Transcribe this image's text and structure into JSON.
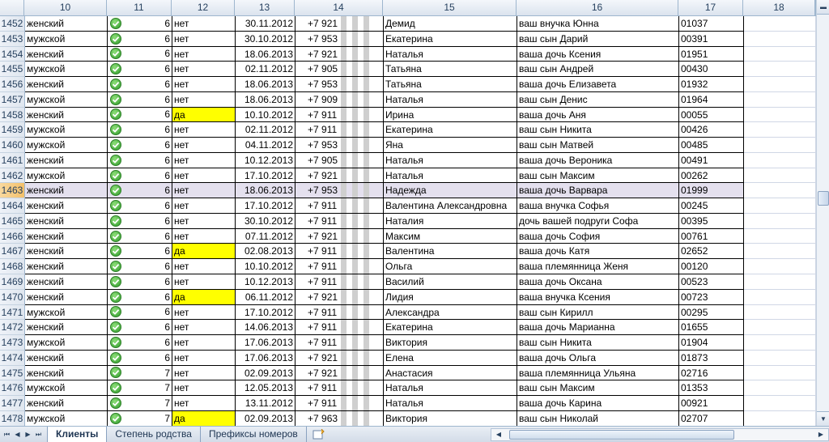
{
  "columns": [
    "10",
    "11",
    "12",
    "13",
    "14",
    "15",
    "16",
    "17",
    "18"
  ],
  "rows": [
    {
      "n": "1452",
      "gender": "женский",
      "num": "6",
      "flag": "нет",
      "date": "30.11.2012",
      "phone": "+7 921",
      "name": "Демид",
      "relation": "ваш внучка Юнна",
      "code": "01037"
    },
    {
      "n": "1453",
      "gender": "мужской",
      "num": "6",
      "flag": "нет",
      "date": "30.10.2012",
      "phone": "+7 953",
      "name": "Екатерина",
      "relation": "ваш сын Дарий",
      "code": "00391"
    },
    {
      "n": "1454",
      "gender": "женский",
      "num": "6",
      "flag": "нет",
      "date": "18.06.2013",
      "phone": "+7 921",
      "name": "Наталья",
      "relation": "ваша дочь Ксения",
      "code": "01951"
    },
    {
      "n": "1455",
      "gender": "мужской",
      "num": "6",
      "flag": "нет",
      "date": "02.11.2012",
      "phone": "+7 905",
      "name": "Татьяна",
      "relation": "ваш сын Андрей",
      "code": "00430"
    },
    {
      "n": "1456",
      "gender": "женский",
      "num": "6",
      "flag": "нет",
      "date": "18.06.2013",
      "phone": "+7 953",
      "name": "Татьяна",
      "relation": "ваша дочь Елизавета",
      "code": "01932"
    },
    {
      "n": "1457",
      "gender": "мужской",
      "num": "6",
      "flag": "нет",
      "date": "18.06.2013",
      "phone": "+7 909",
      "name": "Наталья",
      "relation": "ваш сын Денис",
      "code": "01964"
    },
    {
      "n": "1458",
      "gender": "женский",
      "num": "6",
      "flag": "да",
      "date": "10.10.2012",
      "phone": "+7 911",
      "name": "Ирина",
      "relation": "ваша дочь Аня",
      "code": "00055"
    },
    {
      "n": "1459",
      "gender": "мужской",
      "num": "6",
      "flag": "нет",
      "date": "02.11.2012",
      "phone": "+7 911",
      "name": "Екатерина",
      "relation": "ваш сын Никита",
      "code": "00426"
    },
    {
      "n": "1460",
      "gender": "мужской",
      "num": "6",
      "flag": "нет",
      "date": "04.11.2012",
      "phone": "+7 953",
      "name": "Яна",
      "relation": "ваш сын Матвей",
      "code": "00485"
    },
    {
      "n": "1461",
      "gender": "женский",
      "num": "6",
      "flag": "нет",
      "date": "10.12.2013",
      "phone": "+7 905",
      "name": "Наталья",
      "relation": "ваша дочь Вероника",
      "code": "00491"
    },
    {
      "n": "1462",
      "gender": "мужской",
      "num": "6",
      "flag": "нет",
      "date": "17.10.2012",
      "phone": "+7 921",
      "name": "Наталья",
      "relation": "ваш сын Максим",
      "code": "00262"
    },
    {
      "n": "1463",
      "gender": "женский",
      "num": "6",
      "flag": "нет",
      "date": "18.06.2013",
      "phone": "+7 953",
      "name": "Надежда",
      "relation": "ваша дочь Варвара",
      "code": "01999"
    },
    {
      "n": "1464",
      "gender": "женский",
      "num": "6",
      "flag": "нет",
      "date": "17.10.2012",
      "phone": "+7 911",
      "name": "Валентина Александровна",
      "relation": "ваша внучка Софья",
      "code": "00245"
    },
    {
      "n": "1465",
      "gender": "женский",
      "num": "6",
      "flag": "нет",
      "date": "30.10.2012",
      "phone": "+7 911",
      "name": "Наталия",
      "relation": "дочь вашей подруги Софа",
      "code": "00395"
    },
    {
      "n": "1466",
      "gender": "женский",
      "num": "6",
      "flag": "нет",
      "date": "07.11.2012",
      "phone": "+7 921",
      "name": "Максим",
      "relation": "ваша дочь София",
      "code": "00761"
    },
    {
      "n": "1467",
      "gender": "женский",
      "num": "6",
      "flag": "да",
      "date": "02.08.2013",
      "phone": "+7 911",
      "name": "Валентина",
      "relation": "ваша дочь Катя",
      "code": "02652"
    },
    {
      "n": "1468",
      "gender": "женский",
      "num": "6",
      "flag": "нет",
      "date": "10.10.2012",
      "phone": "+7 911",
      "name": "Ольга",
      "relation": "ваша племянница Женя",
      "code": "00120"
    },
    {
      "n": "1469",
      "gender": "женский",
      "num": "6",
      "flag": "нет",
      "date": "10.12.2013",
      "phone": "+7 911",
      "name": "Василий",
      "relation": "ваша дочь Оксана",
      "code": "00523"
    },
    {
      "n": "1470",
      "gender": "женский",
      "num": "6",
      "flag": "да",
      "date": "06.11.2012",
      "phone": "+7 921",
      "name": "Лидия",
      "relation": "ваша внучка Ксения",
      "code": "00723"
    },
    {
      "n": "1471",
      "gender": "мужской",
      "num": "6",
      "flag": "нет",
      "date": "17.10.2012",
      "phone": "+7 911",
      "name": "Александра",
      "relation": "ваш сын Кирилл",
      "code": "00295"
    },
    {
      "n": "1472",
      "gender": "женский",
      "num": "6",
      "flag": "нет",
      "date": "14.06.2013",
      "phone": "+7 911",
      "name": "Екатерина",
      "relation": "ваша дочь Марианна",
      "code": "01655"
    },
    {
      "n": "1473",
      "gender": "мужской",
      "num": "6",
      "flag": "нет",
      "date": "17.06.2013",
      "phone": "+7 911",
      "name": "Виктория",
      "relation": "ваш сын Никита",
      "code": "01904"
    },
    {
      "n": "1474",
      "gender": "женский",
      "num": "6",
      "flag": "нет",
      "date": "17.06.2013",
      "phone": "+7 921",
      "name": "Елена",
      "relation": "ваша дочь Ольга",
      "code": "01873"
    },
    {
      "n": "1475",
      "gender": "женский",
      "num": "7",
      "flag": "нет",
      "date": "02.09.2013",
      "phone": "+7 921",
      "name": "Анастасия",
      "relation": "ваша племянница Ульяна",
      "code": "02716"
    },
    {
      "n": "1476",
      "gender": "мужской",
      "num": "7",
      "flag": "нет",
      "date": "12.05.2013",
      "phone": "+7 911",
      "name": "Наталья",
      "relation": "ваш сын Максим",
      "code": "01353"
    },
    {
      "n": "1477",
      "gender": "женский",
      "num": "7",
      "flag": "нет",
      "date": "13.11.2012",
      "phone": "+7 911",
      "name": "Наталья",
      "relation": "ваша дочь Карина",
      "code": "00921"
    },
    {
      "n": "1478",
      "gender": "мужской",
      "num": "7",
      "flag": "да",
      "date": "02.09.2013",
      "phone": "+7 963",
      "name": "Виктория",
      "relation": "ваш сын Николай",
      "code": "02707"
    }
  ],
  "selected_row": "1463",
  "highlight_color": "#ffff00",
  "tabs": [
    "Клиенты",
    "Степень родства",
    "Префиксы номеров"
  ],
  "active_tab": "Клиенты"
}
